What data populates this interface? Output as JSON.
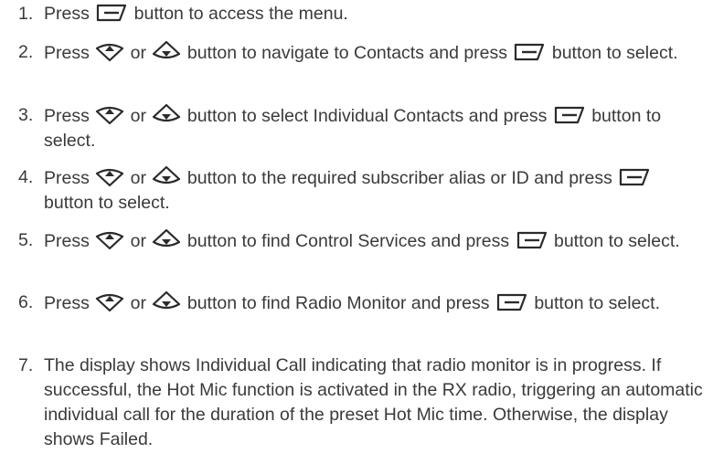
{
  "steps": [
    {
      "num": "1.",
      "parts": [
        "Press ",
        "menu",
        " button to access the menu."
      ]
    },
    {
      "num": "2.",
      "parts": [
        "Press ",
        "up",
        " or ",
        "down",
        " button to navigate to Contacts and press ",
        "menu",
        " button to select."
      ]
    },
    {
      "num": "3.",
      "parts": [
        "Press ",
        "up",
        " or ",
        "down",
        " button to select Individual Contacts and press ",
        "menu",
        " button to select."
      ]
    },
    {
      "num": "4.",
      "parts": [
        "Press ",
        "up",
        " or ",
        "down",
        " button to the required subscriber alias or ID and press ",
        "menu",
        " button to select."
      ]
    },
    {
      "num": "5.",
      "parts": [
        "Press ",
        "up",
        " or ",
        "down",
        " button to find Control Services and press ",
        "menu",
        " button to select."
      ]
    },
    {
      "num": "6.",
      "parts": [
        "Press ",
        "up",
        " or ",
        "down",
        " button to find Radio Monitor and press ",
        "menu",
        " button to select."
      ]
    },
    {
      "num": "7.",
      "parts": [
        "The display shows Individual Call indicating that radio monitor is in progress. If successful, the Hot Mic function is activated in the RX radio, triggering an automatic individual call for the duration of the preset Hot Mic time. Otherwise, the display shows Failed."
      ]
    }
  ],
  "icons": {
    "menu": "menu-ok-button-icon",
    "up": "navigation-up-button-icon",
    "down": "navigation-down-button-icon"
  },
  "colors": {
    "text": "#3a3a3a",
    "icon": "#2b2b2b"
  }
}
